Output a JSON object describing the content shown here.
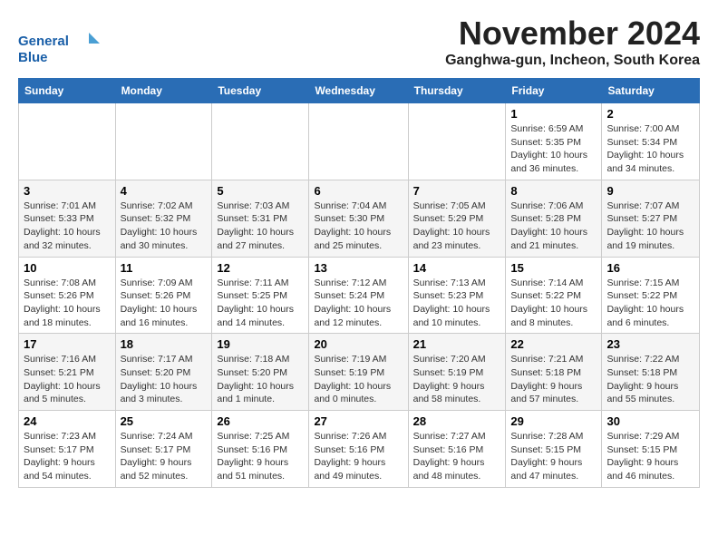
{
  "header": {
    "logo_line1": "General",
    "logo_line2": "Blue",
    "month_title": "November 2024",
    "location": "Ganghwa-gun, Incheon, South Korea"
  },
  "weekdays": [
    "Sunday",
    "Monday",
    "Tuesday",
    "Wednesday",
    "Thursday",
    "Friday",
    "Saturday"
  ],
  "weeks": [
    [
      {
        "day": "",
        "info": ""
      },
      {
        "day": "",
        "info": ""
      },
      {
        "day": "",
        "info": ""
      },
      {
        "day": "",
        "info": ""
      },
      {
        "day": "",
        "info": ""
      },
      {
        "day": "1",
        "info": "Sunrise: 6:59 AM\nSunset: 5:35 PM\nDaylight: 10 hours and 36 minutes."
      },
      {
        "day": "2",
        "info": "Sunrise: 7:00 AM\nSunset: 5:34 PM\nDaylight: 10 hours and 34 minutes."
      }
    ],
    [
      {
        "day": "3",
        "info": "Sunrise: 7:01 AM\nSunset: 5:33 PM\nDaylight: 10 hours and 32 minutes."
      },
      {
        "day": "4",
        "info": "Sunrise: 7:02 AM\nSunset: 5:32 PM\nDaylight: 10 hours and 30 minutes."
      },
      {
        "day": "5",
        "info": "Sunrise: 7:03 AM\nSunset: 5:31 PM\nDaylight: 10 hours and 27 minutes."
      },
      {
        "day": "6",
        "info": "Sunrise: 7:04 AM\nSunset: 5:30 PM\nDaylight: 10 hours and 25 minutes."
      },
      {
        "day": "7",
        "info": "Sunrise: 7:05 AM\nSunset: 5:29 PM\nDaylight: 10 hours and 23 minutes."
      },
      {
        "day": "8",
        "info": "Sunrise: 7:06 AM\nSunset: 5:28 PM\nDaylight: 10 hours and 21 minutes."
      },
      {
        "day": "9",
        "info": "Sunrise: 7:07 AM\nSunset: 5:27 PM\nDaylight: 10 hours and 19 minutes."
      }
    ],
    [
      {
        "day": "10",
        "info": "Sunrise: 7:08 AM\nSunset: 5:26 PM\nDaylight: 10 hours and 18 minutes."
      },
      {
        "day": "11",
        "info": "Sunrise: 7:09 AM\nSunset: 5:26 PM\nDaylight: 10 hours and 16 minutes."
      },
      {
        "day": "12",
        "info": "Sunrise: 7:11 AM\nSunset: 5:25 PM\nDaylight: 10 hours and 14 minutes."
      },
      {
        "day": "13",
        "info": "Sunrise: 7:12 AM\nSunset: 5:24 PM\nDaylight: 10 hours and 12 minutes."
      },
      {
        "day": "14",
        "info": "Sunrise: 7:13 AM\nSunset: 5:23 PM\nDaylight: 10 hours and 10 minutes."
      },
      {
        "day": "15",
        "info": "Sunrise: 7:14 AM\nSunset: 5:22 PM\nDaylight: 10 hours and 8 minutes."
      },
      {
        "day": "16",
        "info": "Sunrise: 7:15 AM\nSunset: 5:22 PM\nDaylight: 10 hours and 6 minutes."
      }
    ],
    [
      {
        "day": "17",
        "info": "Sunrise: 7:16 AM\nSunset: 5:21 PM\nDaylight: 10 hours and 5 minutes."
      },
      {
        "day": "18",
        "info": "Sunrise: 7:17 AM\nSunset: 5:20 PM\nDaylight: 10 hours and 3 minutes."
      },
      {
        "day": "19",
        "info": "Sunrise: 7:18 AM\nSunset: 5:20 PM\nDaylight: 10 hours and 1 minute."
      },
      {
        "day": "20",
        "info": "Sunrise: 7:19 AM\nSunset: 5:19 PM\nDaylight: 10 hours and 0 minutes."
      },
      {
        "day": "21",
        "info": "Sunrise: 7:20 AM\nSunset: 5:19 PM\nDaylight: 9 hours and 58 minutes."
      },
      {
        "day": "22",
        "info": "Sunrise: 7:21 AM\nSunset: 5:18 PM\nDaylight: 9 hours and 57 minutes."
      },
      {
        "day": "23",
        "info": "Sunrise: 7:22 AM\nSunset: 5:18 PM\nDaylight: 9 hours and 55 minutes."
      }
    ],
    [
      {
        "day": "24",
        "info": "Sunrise: 7:23 AM\nSunset: 5:17 PM\nDaylight: 9 hours and 54 minutes."
      },
      {
        "day": "25",
        "info": "Sunrise: 7:24 AM\nSunset: 5:17 PM\nDaylight: 9 hours and 52 minutes."
      },
      {
        "day": "26",
        "info": "Sunrise: 7:25 AM\nSunset: 5:16 PM\nDaylight: 9 hours and 51 minutes."
      },
      {
        "day": "27",
        "info": "Sunrise: 7:26 AM\nSunset: 5:16 PM\nDaylight: 9 hours and 49 minutes."
      },
      {
        "day": "28",
        "info": "Sunrise: 7:27 AM\nSunset: 5:16 PM\nDaylight: 9 hours and 48 minutes."
      },
      {
        "day": "29",
        "info": "Sunrise: 7:28 AM\nSunset: 5:15 PM\nDaylight: 9 hours and 47 minutes."
      },
      {
        "day": "30",
        "info": "Sunrise: 7:29 AM\nSunset: 5:15 PM\nDaylight: 9 hours and 46 minutes."
      }
    ]
  ]
}
